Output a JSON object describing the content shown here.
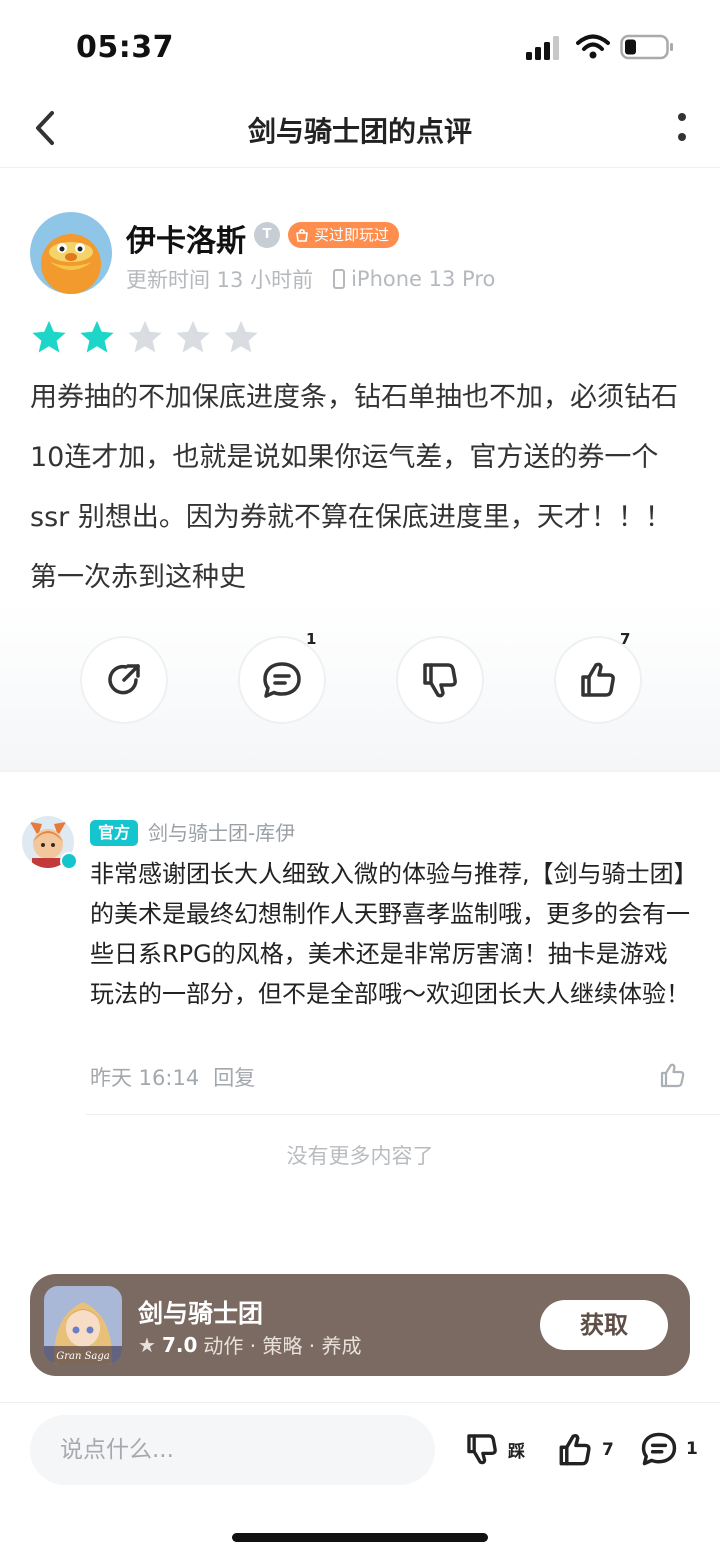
{
  "status_bar": {
    "time": "05:37"
  },
  "nav": {
    "title": "剑与骑士团的点评"
  },
  "review": {
    "user_name": "伊卡洛斯",
    "level_badge": "T",
    "played_badge": "买过即玩过",
    "updated_time": "更新时间 13 小时前",
    "device": "iPhone 13 Pro",
    "rating": 2,
    "rating_max": 5,
    "text": "用券抽的不加保底进度条，钻石单抽也不加，必须钻石10连才加，也就是说如果你运气差，官方送的券一个ssr 别想出。因为券就不算在保底进度里，天才！！！ 第一次赤到这种史",
    "comment_count": "1",
    "like_count": "7"
  },
  "reply": {
    "official_tag": "官方",
    "author": "剑与骑士团-库伊",
    "text": "非常感谢团长大人细致入微的体验与推荐,【剑与骑士团】的美术是最终幻想制作人天野喜孝监制哦，更多的会有一些日系RPG的风格，美术还是非常厉害滴！抽卡是游戏玩法的一部分，但不是全部哦～欢迎团长大人继续体验！",
    "time": "昨天 16:14",
    "reply_label": "回复"
  },
  "no_more": "没有更多内容了",
  "game": {
    "name": "剑与骑士团",
    "icon_text": "Gran Saga",
    "score": "7.0",
    "tags": "动作 · 策略 · 养成",
    "get_label": "获取"
  },
  "bottom_bar": {
    "input_placeholder": "说点什么...",
    "dislike_label": "踩",
    "like_count": "7",
    "comment_count": "1"
  },
  "colors": {
    "accent": "#15c5ce",
    "star_active": "#1ed6c8",
    "star_inactive": "#d9dde1",
    "played_badge": "#ff8d4d",
    "game_card": "#7b6a61"
  }
}
